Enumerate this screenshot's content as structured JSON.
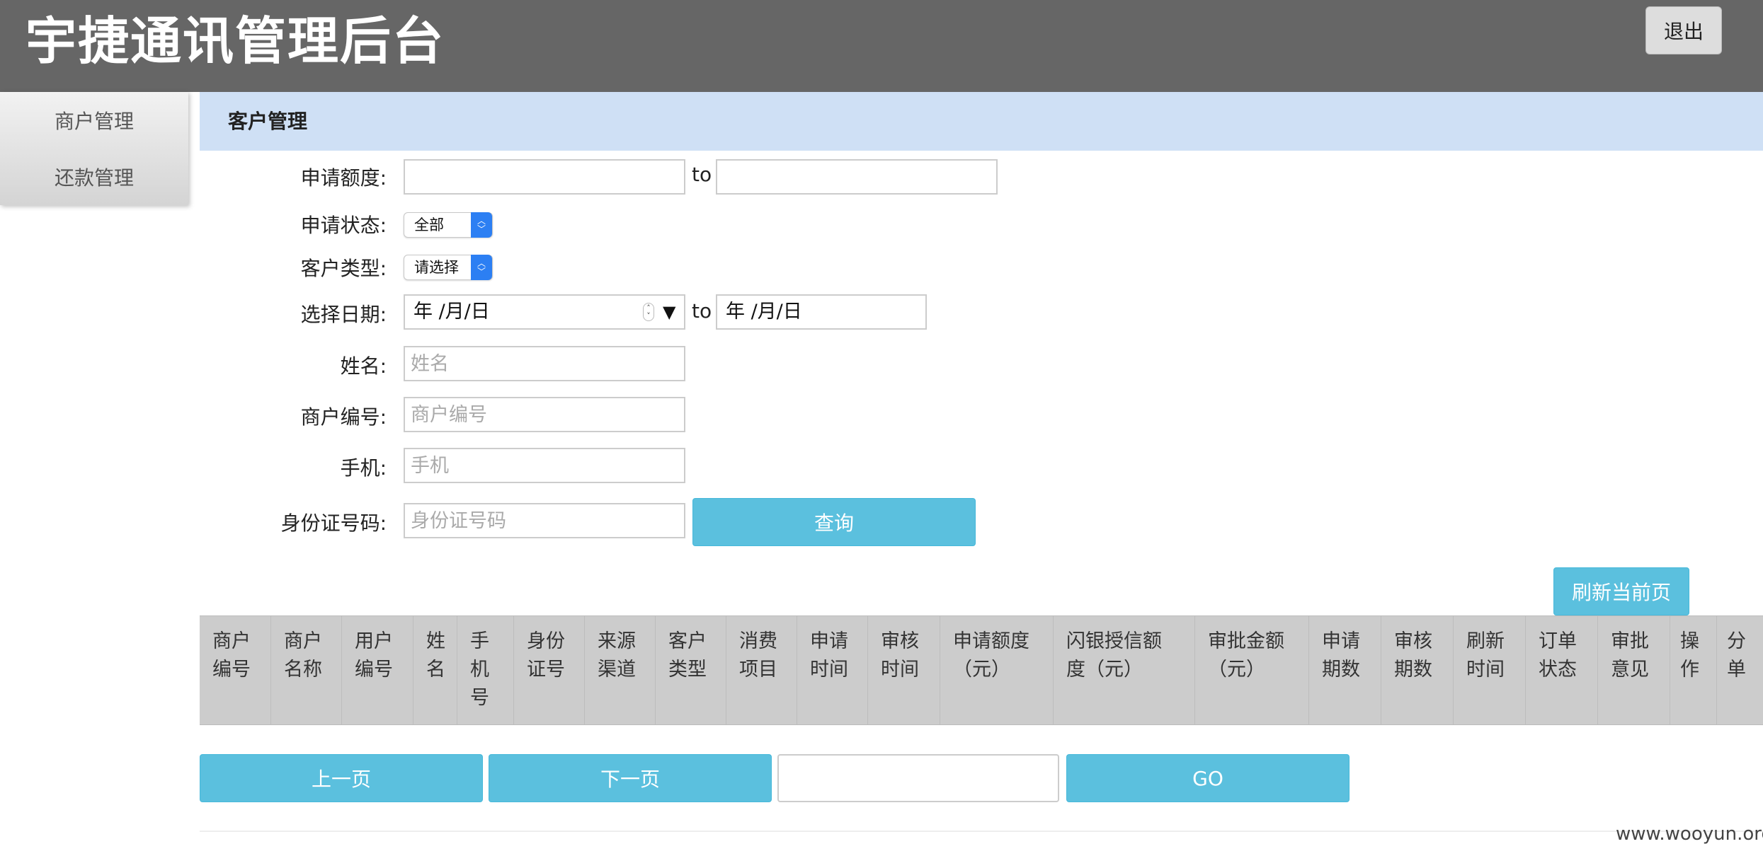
{
  "header": {
    "title": "宇捷通讯管理后台",
    "logout_label": "退出"
  },
  "sidebar": {
    "items": [
      {
        "label": "商户管理"
      },
      {
        "label": "还款管理"
      }
    ]
  },
  "section": {
    "title": "客户管理"
  },
  "form": {
    "amount_label": "申请额度:",
    "to_label": "to",
    "status_label": "申请状态:",
    "status_selected": "全部",
    "customer_type_label": "客户类型:",
    "customer_type_selected": "请选择",
    "date_label": "选择日期:",
    "date_from_value": "年 /月/日",
    "date_to_value": "年 /月/日",
    "name_label": "姓名:",
    "name_placeholder": "姓名",
    "merchant_no_label": "商户编号:",
    "merchant_no_placeholder": "商户编号",
    "phone_label": "手机:",
    "phone_placeholder": "手机",
    "id_label": "身份证号码:",
    "id_placeholder": "身份证号码",
    "query_label": "查询"
  },
  "refresh_label": "刷新当前页",
  "table": {
    "columns": [
      [
        "商户",
        "编号"
      ],
      [
        "商户",
        "名称"
      ],
      [
        "用户",
        "编号"
      ],
      [
        "姓",
        "名"
      ],
      [
        "手",
        "机",
        "号"
      ],
      [
        "身份",
        "证号"
      ],
      [
        "来源",
        "渠道"
      ],
      [
        "客户",
        "类型"
      ],
      [
        "消费",
        "项目"
      ],
      [
        "申请",
        "时间"
      ],
      [
        "审核",
        "时间"
      ],
      [
        "申请额度",
        "（元）"
      ],
      [
        "闪银授信额",
        "度（元）"
      ],
      [
        "审批金额",
        "（元）"
      ],
      [
        "申请",
        "期数"
      ],
      [
        "审核",
        "期数"
      ],
      [
        "刷新",
        "时间"
      ],
      [
        "订单",
        "状态"
      ],
      [
        "审批",
        "意见"
      ],
      [
        "操",
        "作"
      ],
      [
        "分",
        "单"
      ]
    ]
  },
  "pager": {
    "prev_label": "上一页",
    "next_label": "下一页",
    "go_label": "GO"
  },
  "watermark": "www.wooyun.org"
}
